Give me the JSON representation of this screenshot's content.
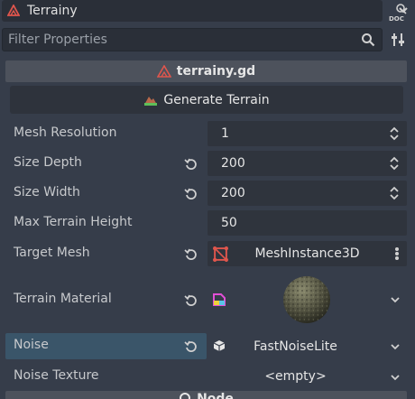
{
  "object_selector": {
    "name": "Terrainy",
    "icon": "terrain-node-icon"
  },
  "filter": {
    "placeholder": "Filter Properties"
  },
  "script": {
    "name": "terrainy.gd",
    "icon": "script-warning-icon"
  },
  "generate_button": {
    "label": "Generate Terrain",
    "icon": "terrain-tool-icon"
  },
  "properties": {
    "mesh_resolution": {
      "label": "Mesh Resolution",
      "value": "1"
    },
    "size_depth": {
      "label": "Size Depth",
      "value": "200"
    },
    "size_width": {
      "label": "Size Width",
      "value": "200"
    },
    "max_terrain_height": {
      "label": "Max Terrain Height",
      "value": "50"
    },
    "target_mesh": {
      "label": "Target Mesh",
      "value": "MeshInstance3D"
    },
    "terrain_material": {
      "label": "Terrain Material"
    },
    "noise": {
      "label": "Noise",
      "value": "FastNoiseLite"
    },
    "noise_texture": {
      "label": "Noise Texture",
      "value": "<empty>"
    }
  },
  "section": {
    "node_label": "Node"
  },
  "colors": {
    "background": "#363d4a",
    "field": "#2f343d",
    "selected_row": "#3a5569",
    "header": "#4d525c",
    "accent_red": "#e0564d"
  }
}
